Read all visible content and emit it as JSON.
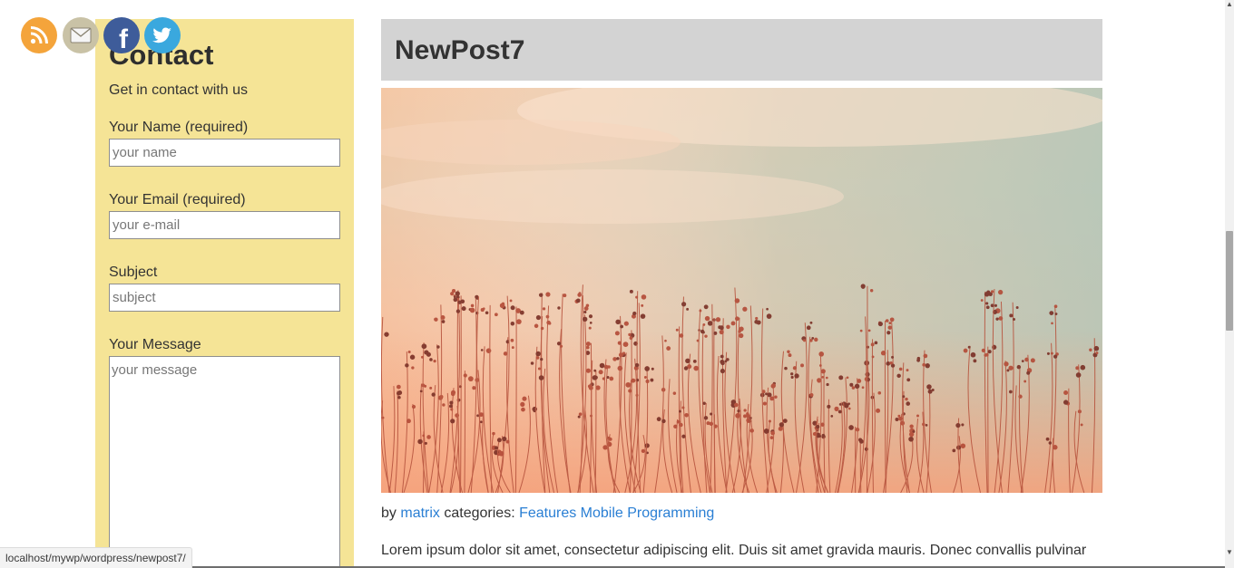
{
  "social": {
    "icons": [
      "rss-icon",
      "mail-icon",
      "facebook-icon",
      "twitter-icon"
    ]
  },
  "contact": {
    "title": "Contact",
    "subtitle": "Get in contact with us",
    "name_label": "Your Name (required)",
    "name_placeholder": "your name",
    "email_label": "Your Email (required)",
    "email_placeholder": "your e-mail",
    "subject_label": "Subject",
    "subject_placeholder": "subject",
    "message_label": "Your Message",
    "message_placeholder": "your message"
  },
  "post": {
    "title": "NewPost7",
    "by_text": "by",
    "author": "matrix",
    "categories_text": "categories:",
    "categories": "Features Mobile Programming",
    "excerpt": "Lorem ipsum dolor sit amet, consectetur adipiscing elit. Duis sit amet gravida mauris. Donec convallis pulvinar"
  },
  "status_bar": {
    "url": "localhost/mywp/wordpress/newpost7/"
  },
  "colors": {
    "sidebar_bg": "#f5e496",
    "header_bg": "#d3d3d3",
    "link": "#2a7fd4"
  }
}
